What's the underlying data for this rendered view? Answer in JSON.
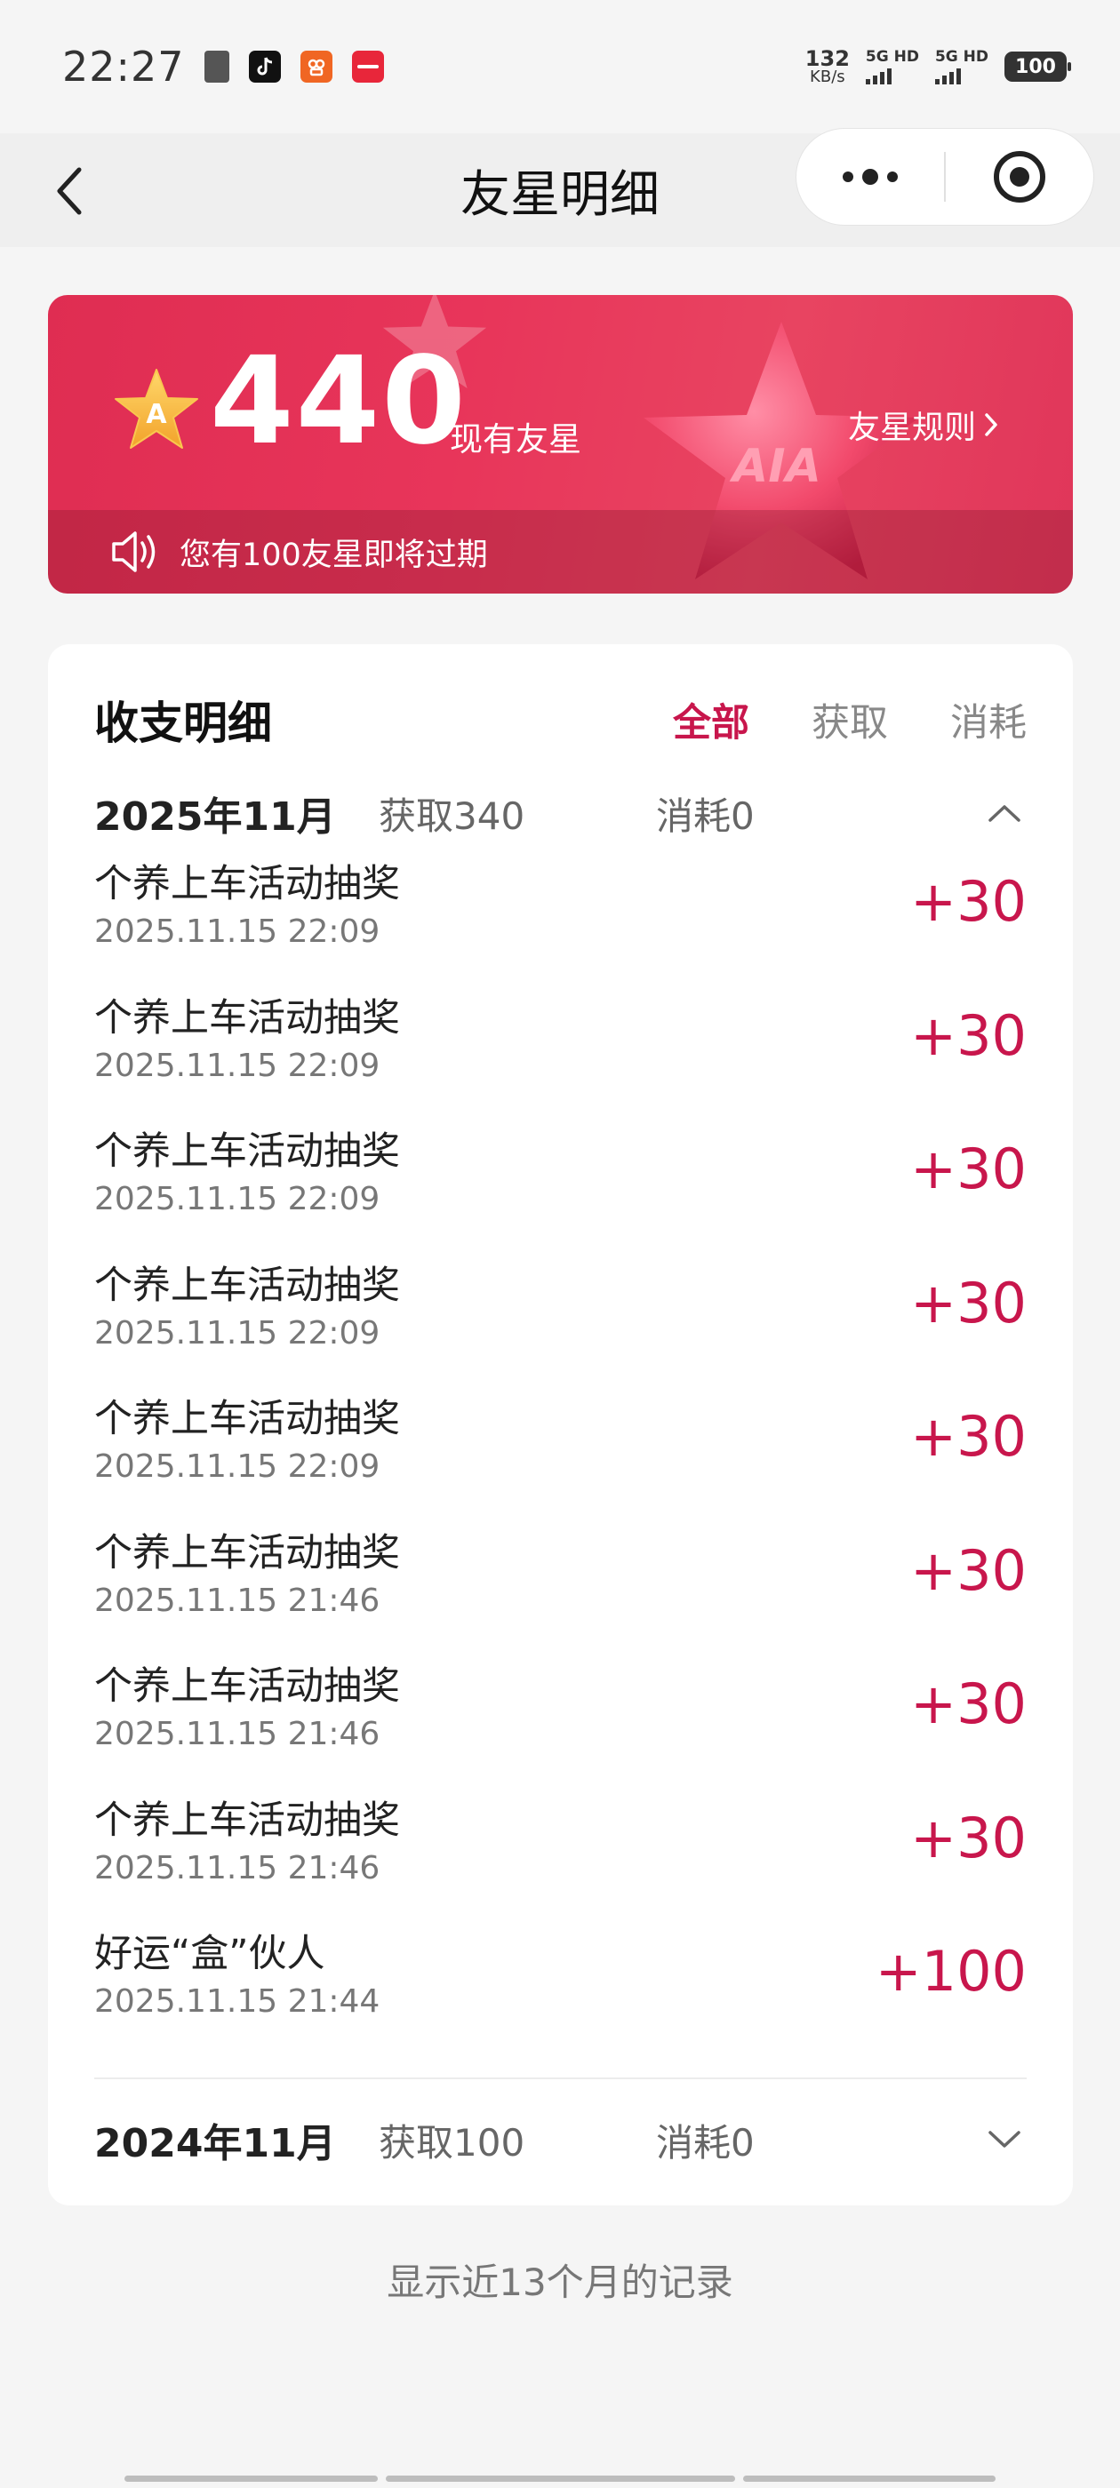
{
  "status_bar": {
    "time": "22:27",
    "app_icons": [
      {
        "name": "clipboard-icon",
        "color": "#555555",
        "glyph": "▮"
      },
      {
        "name": "tiktok-icon",
        "color": "#111111",
        "glyph": "♪"
      },
      {
        "name": "kuaishou-icon",
        "color": "#f06623",
        "glyph": "oo"
      },
      {
        "name": "xiaohongshu-icon",
        "color": "#e8263a",
        "glyph": "小红书"
      }
    ],
    "net_speed": "132",
    "net_unit": "KB/s",
    "sim1": "5G HD",
    "sim2": "5G HD",
    "battery": "100"
  },
  "nav": {
    "title": "友星明细"
  },
  "banner": {
    "balance": "440",
    "balance_label": "现有友星",
    "rules_label": "友星规则",
    "expire_notice": "您有100友星即将过期",
    "badge_letter": "A",
    "star_text": "AIA"
  },
  "records": {
    "title": "收支明细",
    "filters": [
      "全部",
      "获取",
      "消耗"
    ],
    "months": [
      {
        "label": "2025年11月",
        "gain": "获取340",
        "cost": "消耗0",
        "expanded": true
      },
      {
        "label": "2024年11月",
        "gain": "获取100",
        "cost": "消耗0",
        "expanded": false
      }
    ],
    "items": [
      {
        "name": "个养上车活动抽奖",
        "time": "2025.11.15 22:09",
        "amount": "+30"
      },
      {
        "name": "个养上车活动抽奖",
        "time": "2025.11.15 22:09",
        "amount": "+30"
      },
      {
        "name": "个养上车活动抽奖",
        "time": "2025.11.15 22:09",
        "amount": "+30"
      },
      {
        "name": "个养上车活动抽奖",
        "time": "2025.11.15 22:09",
        "amount": "+30"
      },
      {
        "name": "个养上车活动抽奖",
        "time": "2025.11.15 22:09",
        "amount": "+30"
      },
      {
        "name": "个养上车活动抽奖",
        "time": "2025.11.15 21:46",
        "amount": "+30"
      },
      {
        "name": "个养上车活动抽奖",
        "time": "2025.11.15 21:46",
        "amount": "+30"
      },
      {
        "name": "个养上车活动抽奖",
        "time": "2025.11.15 21:46",
        "amount": "+30"
      },
      {
        "name": "好运“盒”伙人",
        "time": "2025.11.15 21:44",
        "amount": "+100"
      }
    ]
  },
  "footer_note": "显示近13个月的记录",
  "colors": {
    "accent": "#c8164c",
    "banner": "#e8355a",
    "background": "#f5f5f5"
  }
}
